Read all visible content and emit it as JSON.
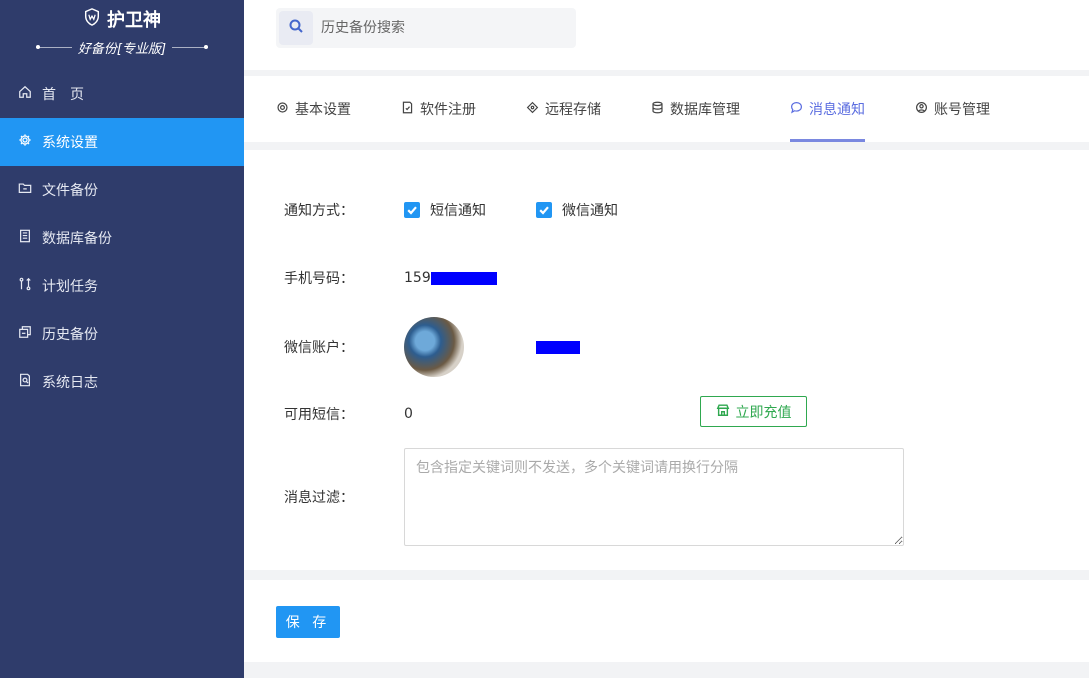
{
  "brand": {
    "title": "护卫神",
    "subtitle": "好备份[专业版]"
  },
  "sidebar": {
    "items": [
      {
        "label": "首　页",
        "icon": "home-icon"
      },
      {
        "label": "系统设置",
        "icon": "gear-icon",
        "active": true
      },
      {
        "label": "文件备份",
        "icon": "folder-icon"
      },
      {
        "label": "数据库备份",
        "icon": "database-icon"
      },
      {
        "label": "计划任务",
        "icon": "schedule-icon"
      },
      {
        "label": "历史备份",
        "icon": "history-icon"
      },
      {
        "label": "系统日志",
        "icon": "log-icon"
      }
    ]
  },
  "search": {
    "placeholder": "历史备份搜索"
  },
  "tabs": [
    {
      "label": "基本设置",
      "icon": "gear-icon"
    },
    {
      "label": "软件注册",
      "icon": "register-icon"
    },
    {
      "label": "远程存储",
      "icon": "remote-icon"
    },
    {
      "label": "数据库管理",
      "icon": "database-icon"
    },
    {
      "label": "消息通知",
      "icon": "chat-icon",
      "active": true
    },
    {
      "label": "账号管理",
      "icon": "account-icon"
    }
  ],
  "form": {
    "notify_label": "通知方式：",
    "sms_label": "短信通知",
    "wechat_label": "微信通知",
    "phone_label": "手机号码：",
    "phone_value": "159",
    "wechat_account_label": "微信账户：",
    "sms_available_label": "可用短信：",
    "sms_available_value": "0",
    "recharge_label": "立即充值",
    "filter_label": "消息过滤：",
    "filter_placeholder": "包含指定关键词则不发送，多个关键词请用换行分隔"
  },
  "footer": {
    "save_label": "保 存"
  },
  "colors": {
    "sidebar": "#2f3c6b",
    "accent": "#2196f3",
    "tab_active": "#5b6de0",
    "recharge": "#2fa84f",
    "mask": "#0000ff"
  }
}
